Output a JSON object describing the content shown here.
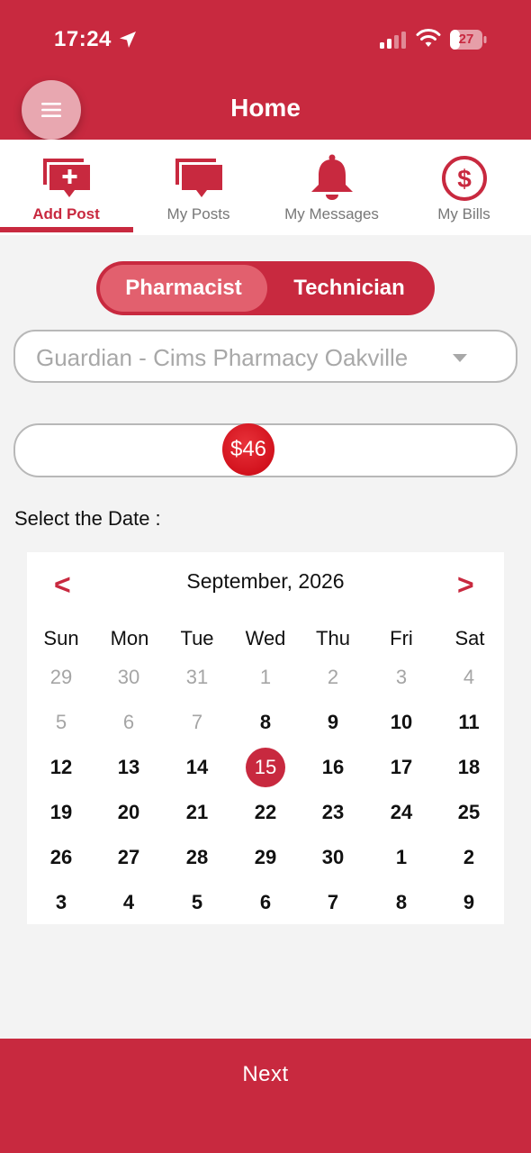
{
  "status_bar": {
    "time": "17:24",
    "battery": "27",
    "icons": [
      "location-arrow-icon",
      "cellular-signal-icon",
      "wifi-icon",
      "battery-icon"
    ]
  },
  "header": {
    "title": "Home",
    "menu_icon": "hamburger-icon",
    "background": "#c8293f"
  },
  "tabs": [
    {
      "label": "Add Post",
      "icon": "add-post-icon",
      "active": true
    },
    {
      "label": "My Posts",
      "icon": "posts-icon",
      "active": false
    },
    {
      "label": "My Messages",
      "icon": "bell-icon",
      "active": false
    },
    {
      "label": "My Bills",
      "icon": "dollar-icon",
      "active": false
    }
  ],
  "role_toggle": {
    "options": [
      "Pharmacist",
      "Technician"
    ],
    "selected": "Pharmacist"
  },
  "pharmacy_select": {
    "value": "Guardian - Cims Pharmacy Oakville"
  },
  "rate_slider": {
    "value_label": "$46",
    "value": 46
  },
  "date_section": {
    "label": "Select the Date :"
  },
  "calendar": {
    "prev": "<",
    "next": ">",
    "title": "September, 2026",
    "weekdays": [
      "Sun",
      "Mon",
      "Tue",
      "Wed",
      "Thu",
      "Fri",
      "Sat"
    ],
    "weeks": [
      [
        "29",
        "30",
        "31",
        "1",
        "2",
        "3",
        "4"
      ],
      [
        "5",
        "6",
        "7",
        "8",
        "9",
        "10",
        "11"
      ],
      [
        "12",
        "13",
        "14",
        "15",
        "16",
        "17",
        "18"
      ],
      [
        "19",
        "20",
        "21",
        "22",
        "23",
        "24",
        "25"
      ],
      [
        "26",
        "27",
        "28",
        "29",
        "30",
        "1",
        "2"
      ],
      [
        "3",
        "4",
        "5",
        "6",
        "7",
        "8",
        "9"
      ]
    ],
    "muted_count": 10,
    "selected_day": "15",
    "accent": "#c8293f"
  },
  "footer": {
    "next_label": "Next"
  }
}
